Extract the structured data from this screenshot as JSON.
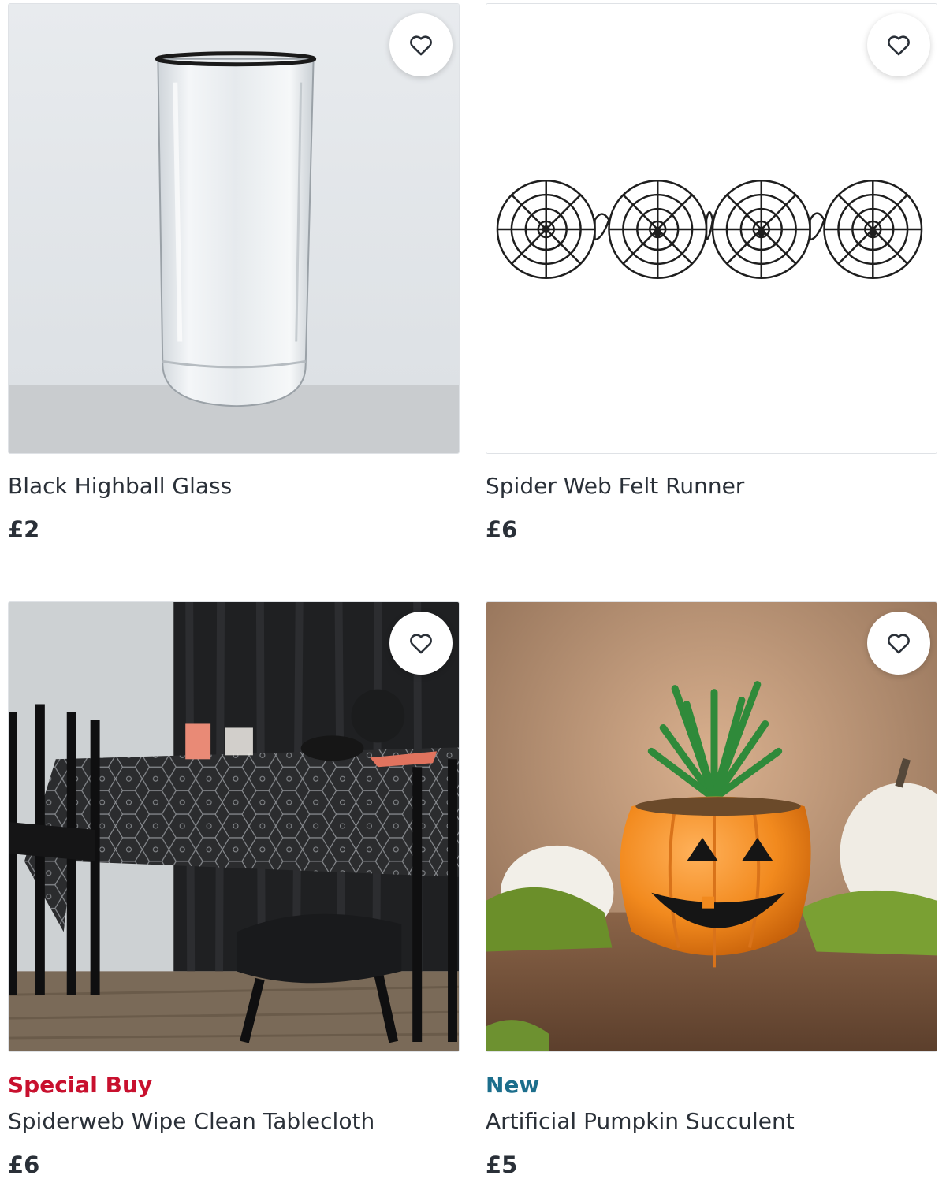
{
  "products": [
    {
      "title": "Black Highball Glass",
      "price": "£2",
      "badge": ""
    },
    {
      "title": "Spider Web Felt Runner",
      "price": "£6",
      "badge": ""
    },
    {
      "title": "Spiderweb Wipe Clean Tablecloth",
      "price": "£6",
      "badge": "Special Buy"
    },
    {
      "title": "Artificial Pumpkin Succulent",
      "price": "£5",
      "badge": "New"
    }
  ],
  "colors": {
    "special_buy": "#c8102e",
    "new": "#1c6e8c",
    "text": "#2a3038"
  },
  "icons": {
    "favourite": "heart-outline-icon"
  }
}
